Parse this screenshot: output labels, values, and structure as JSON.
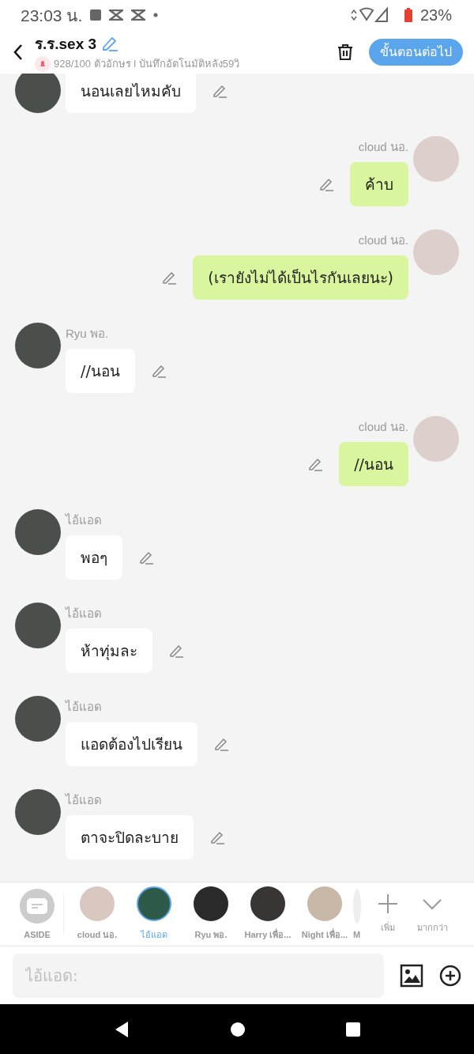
{
  "status_bar": {
    "time": "23:03 น.",
    "battery": "23%"
  },
  "header": {
    "title": "ร.ร.sex 3",
    "subtitle": "928/100 ตัวอักษร l บันทึกอัตโนมัติหลัง59วิ",
    "next_button": "ขั้นตอนต่อไป"
  },
  "messages": [
    {
      "kind": "incoming",
      "text": "นอนเลยไหมคับ"
    },
    {
      "kind": "outgoing",
      "sender": "cloud นอ.",
      "text": "ค้าบ"
    },
    {
      "kind": "outgoing",
      "sender": "cloud นอ.",
      "text": "(เรายังไม่ได้เป็นไรกันเลยนะ)"
    },
    {
      "kind": "incoming",
      "sender": "Ryu พอ.",
      "text": "//นอน"
    },
    {
      "kind": "outgoing",
      "sender": "cloud นอ.",
      "text": "//นอน"
    },
    {
      "kind": "incoming",
      "sender": "ไอ้แอด",
      "text": "พอๆ"
    },
    {
      "kind": "incoming",
      "sender": "ไอ้แอด",
      "text": "ห้าทุ่มละ"
    },
    {
      "kind": "incoming",
      "sender": "ไอ้แอด",
      "text": "แอดต้องไปเรียน"
    },
    {
      "kind": "incoming",
      "sender": "ไอ้แอด",
      "text": "ตาจะปิดละบาย"
    }
  ],
  "characters": [
    {
      "kind": "aside",
      "name": "ASIDE",
      "selected": false
    },
    {
      "kind": "character",
      "name": "cloud นอ.",
      "selected": false
    },
    {
      "kind": "character",
      "name": "ไอ้แอด",
      "selected": true
    },
    {
      "kind": "character",
      "name": "Ryu พอ.",
      "selected": false
    },
    {
      "kind": "character",
      "name": "Harry เพื่อ...",
      "selected": false
    },
    {
      "kind": "character",
      "name": "Night เพื่อ...",
      "selected": false
    },
    {
      "kind": "cut",
      "name": "M",
      "selected": false
    }
  ],
  "actions": [
    {
      "kind": "add",
      "label": "เพิ่ม"
    },
    {
      "kind": "more",
      "label": "มากกว่า"
    }
  ],
  "input": {
    "placeholder": "ไอ้แอด:"
  }
}
